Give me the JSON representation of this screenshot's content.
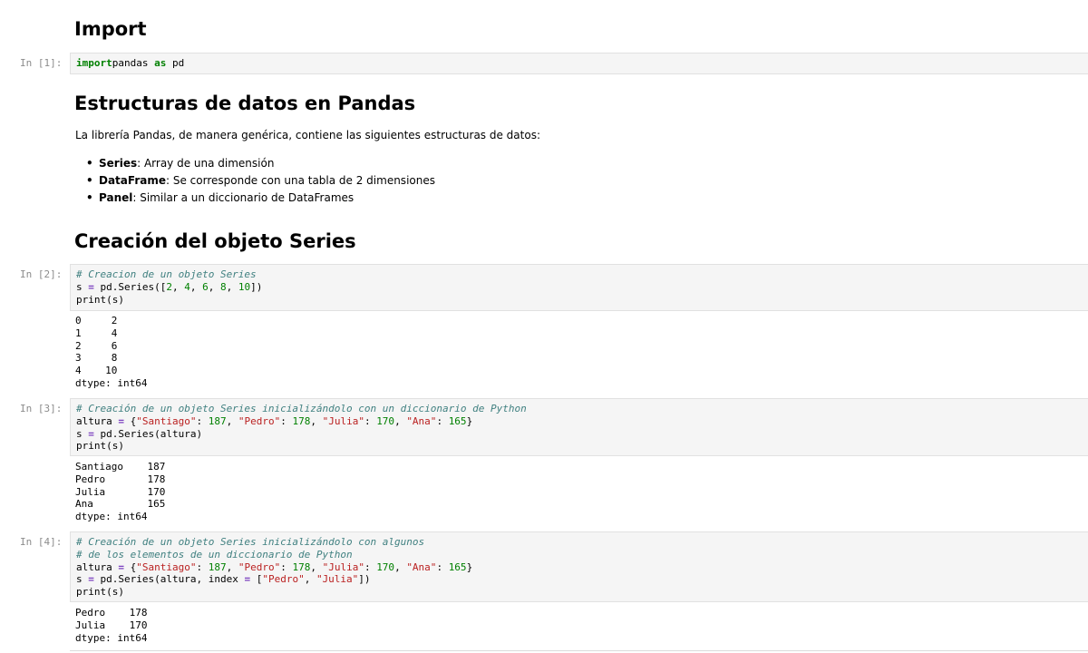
{
  "headings": {
    "import": "Import",
    "structures": "Estructuras de datos en Pandas",
    "series_creation": "Creación del objeto Series"
  },
  "intro_paragraph": "La librería Pandas, de manera genérica, contiene las siguientes estructuras de datos:",
  "bullets": [
    {
      "term": "Series",
      "desc": ": Array de una dimensión"
    },
    {
      "term": "DataFrame",
      "desc": ": Se corresponde con una tabla de 2 dimensiones"
    },
    {
      "term": "Panel",
      "desc": ": Similar a un diccionario de DataFrames"
    }
  ],
  "cells": [
    {
      "prompt": "In [1]:",
      "code": [
        [
          [
            "kw",
            "import"
          ],
          [
            "",
            "pandas "
          ],
          [
            "kw",
            "as"
          ],
          [
            "",
            " pd"
          ]
        ]
      ],
      "output": []
    },
    {
      "prompt": "In [2]:",
      "code": [
        [
          [
            "cm",
            "# Creacion de un objeto Series"
          ]
        ],
        [
          [
            "",
            "s "
          ],
          [
            "op",
            "="
          ],
          [
            "",
            " pd.Series(["
          ],
          [
            "num",
            "2"
          ],
          [
            "",
            ", "
          ],
          [
            "num",
            "4"
          ],
          [
            "",
            ", "
          ],
          [
            "num",
            "6"
          ],
          [
            "",
            ", "
          ],
          [
            "num",
            "8"
          ],
          [
            "",
            ", "
          ],
          [
            "num",
            "10"
          ],
          [
            "",
            "])"
          ]
        ],
        [
          [
            "",
            "print(s)"
          ]
        ]
      ],
      "output": [
        "0     2",
        "1     4",
        "2     6",
        "3     8",
        "4    10",
        "dtype: int64"
      ]
    },
    {
      "prompt": "In [3]:",
      "code": [
        [
          [
            "cm",
            "# Creación de un objeto Series inicializándolo con un diccionario de Python"
          ]
        ],
        [
          [
            "",
            "altura "
          ],
          [
            "op",
            "="
          ],
          [
            "",
            " {"
          ],
          [
            "str",
            "\"Santiago\""
          ],
          [
            "",
            ": "
          ],
          [
            "num",
            "187"
          ],
          [
            "",
            ", "
          ],
          [
            "str",
            "\"Pedro\""
          ],
          [
            "",
            ": "
          ],
          [
            "num",
            "178"
          ],
          [
            "",
            ", "
          ],
          [
            "str",
            "\"Julia\""
          ],
          [
            "",
            ": "
          ],
          [
            "num",
            "170"
          ],
          [
            "",
            ", "
          ],
          [
            "str",
            "\"Ana\""
          ],
          [
            "",
            ": "
          ],
          [
            "num",
            "165"
          ],
          [
            "",
            "}"
          ]
        ],
        [
          [
            "",
            "s "
          ],
          [
            "op",
            "="
          ],
          [
            "",
            " pd.Series(altura)"
          ]
        ],
        [
          [
            "",
            "print(s)"
          ]
        ]
      ],
      "output": [
        "Santiago    187",
        "Pedro       178",
        "Julia       170",
        "Ana         165",
        "dtype: int64"
      ]
    },
    {
      "prompt": "In [4]:",
      "code": [
        [
          [
            "cm",
            "# Creación de un objeto Series inicializándolo con algunos"
          ]
        ],
        [
          [
            "cm",
            "# de los elementos de un diccionario de Python"
          ]
        ],
        [
          [
            "",
            "altura "
          ],
          [
            "op",
            "="
          ],
          [
            "",
            " {"
          ],
          [
            "str",
            "\"Santiago\""
          ],
          [
            "",
            ": "
          ],
          [
            "num",
            "187"
          ],
          [
            "",
            ", "
          ],
          [
            "str",
            "\"Pedro\""
          ],
          [
            "",
            ": "
          ],
          [
            "num",
            "178"
          ],
          [
            "",
            ", "
          ],
          [
            "str",
            "\"Julia\""
          ],
          [
            "",
            ": "
          ],
          [
            "num",
            "170"
          ],
          [
            "",
            ", "
          ],
          [
            "str",
            "\"Ana\""
          ],
          [
            "",
            ": "
          ],
          [
            "num",
            "165"
          ],
          [
            "",
            "}"
          ]
        ],
        [
          [
            "",
            "s "
          ],
          [
            "op",
            "="
          ],
          [
            "",
            " pd.Series(altura, index "
          ],
          [
            "op",
            "="
          ],
          [
            "",
            " ["
          ],
          [
            "str",
            "\"Pedro\""
          ],
          [
            "",
            ", "
          ],
          [
            "str",
            "\"Julia\""
          ],
          [
            "",
            "])"
          ]
        ],
        [
          [
            "",
            "print(s)"
          ]
        ]
      ],
      "output": [
        "Pedro    178",
        "Julia    170",
        "dtype: int64"
      ]
    }
  ]
}
